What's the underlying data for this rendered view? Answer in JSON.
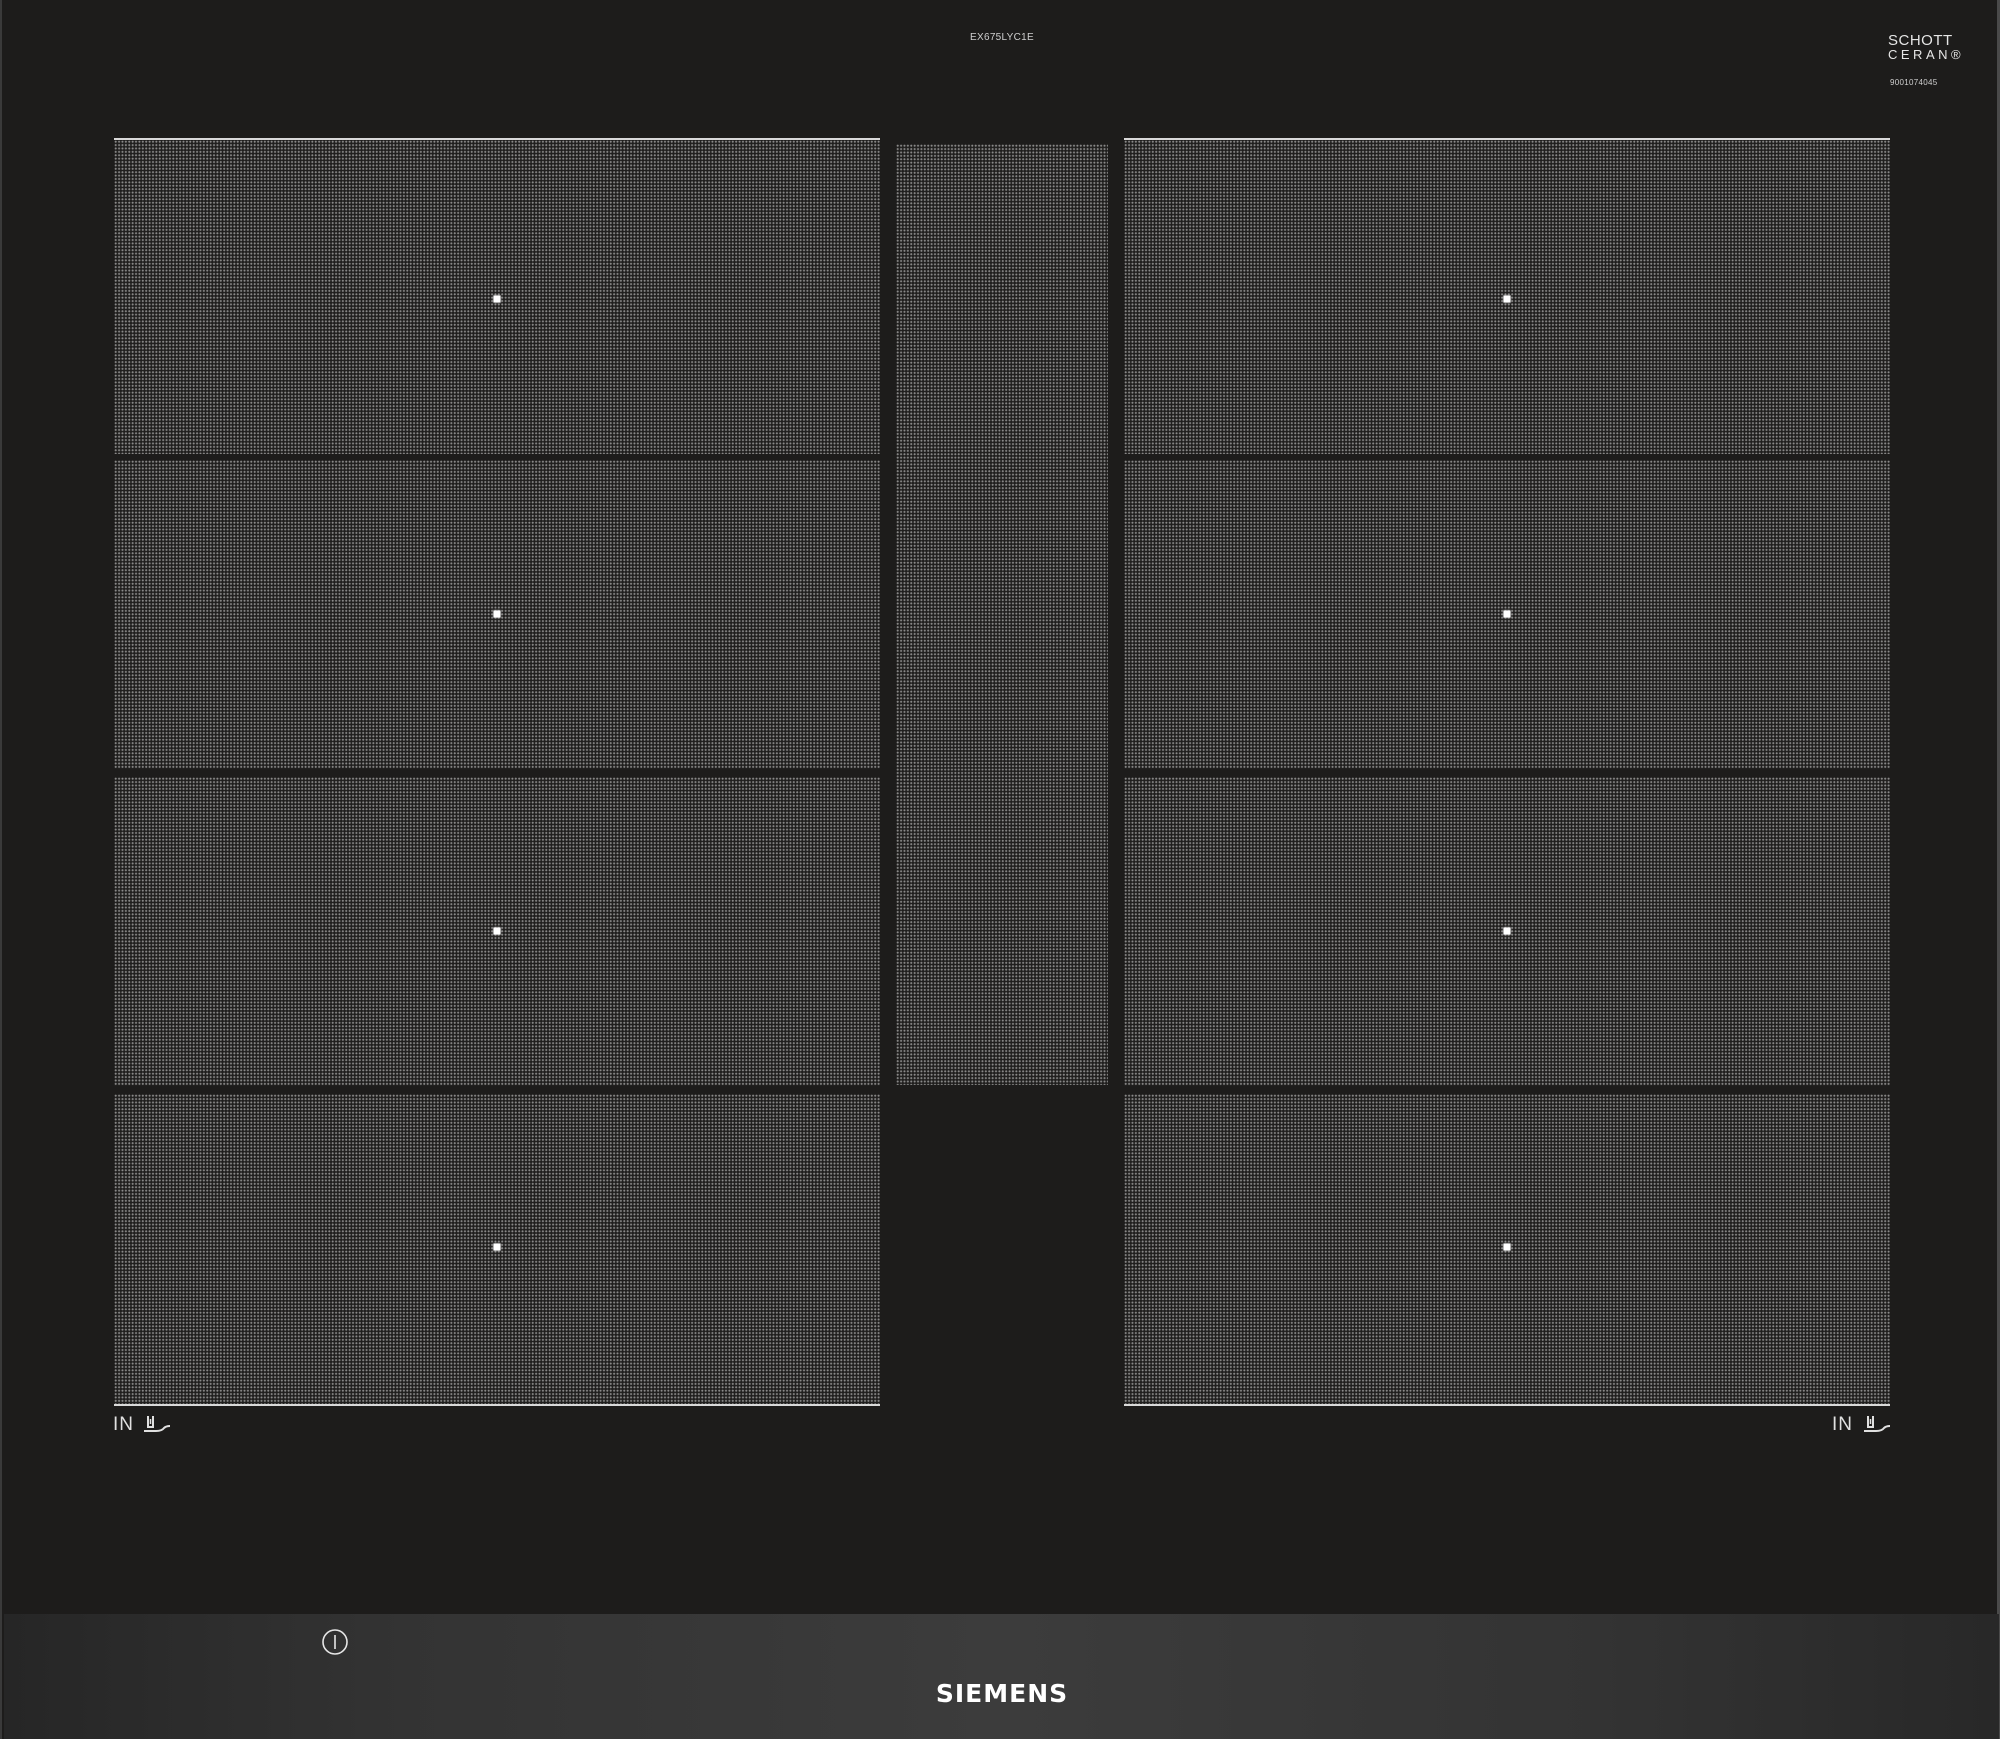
{
  "model_number": "EX675LYC1E",
  "glass_brand": {
    "line1": "SCHOTT",
    "line2": "CERAN®",
    "number": "9001074045"
  },
  "brand": "SIEMENS",
  "cooking_zones": {
    "left_label": "IN",
    "right_label": "IN",
    "left_icon": "pan-on-burner-icon",
    "right_icon": "pan-on-burner-icon"
  },
  "controls": {
    "power_icon": "power-icon"
  },
  "colors": {
    "glass": "#1d1c1b",
    "marks": "#ffffff"
  }
}
